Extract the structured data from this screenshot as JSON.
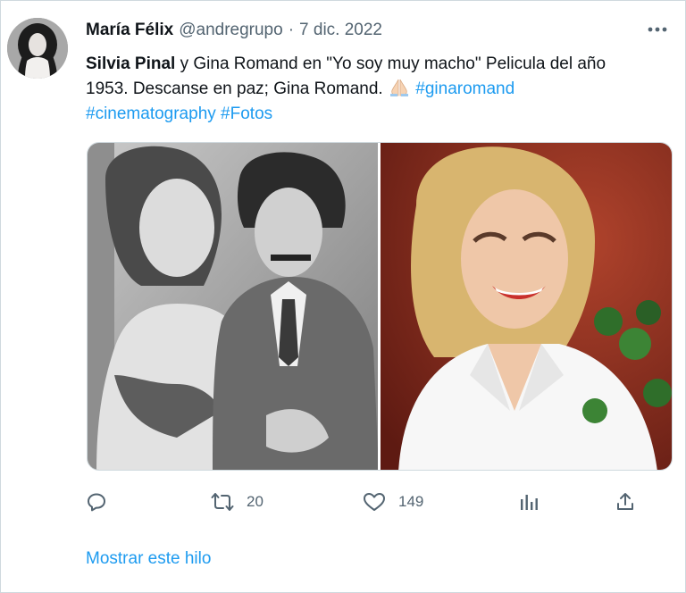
{
  "tweet": {
    "author": {
      "display_name": "María Félix",
      "handle": "@andregrupo",
      "avatar_icon": "portrait-avatar"
    },
    "separator": "·",
    "date": "7 dic. 2022",
    "text": {
      "mention": "Silvia Pinal",
      "body_1": " y Gina Romand en \"Yo soy muy macho\"  Pelicula del año 1953. Descanse en paz; Gina Romand. ",
      "emoji": "folded-hands",
      "hashtags": [
        "#ginaromand",
        "#cinematography",
        "#Fotos"
      ]
    },
    "media": [
      {
        "icon": "black-and-white-film-still"
      },
      {
        "icon": "color-portrait-photo"
      }
    ],
    "actions": {
      "reply": {
        "icon": "reply-icon",
        "count": ""
      },
      "retweet": {
        "icon": "retweet-icon",
        "count": "20"
      },
      "like": {
        "icon": "heart-icon",
        "count": "149"
      },
      "analytics": {
        "icon": "analytics-icon",
        "count": ""
      },
      "share": {
        "icon": "share-icon",
        "count": ""
      }
    },
    "show_thread": "Mostrar este hilo"
  },
  "colors": {
    "text": "#0f1419",
    "secondary": "#536471",
    "link": "#1d9bf0",
    "border": "#cfd9de"
  }
}
